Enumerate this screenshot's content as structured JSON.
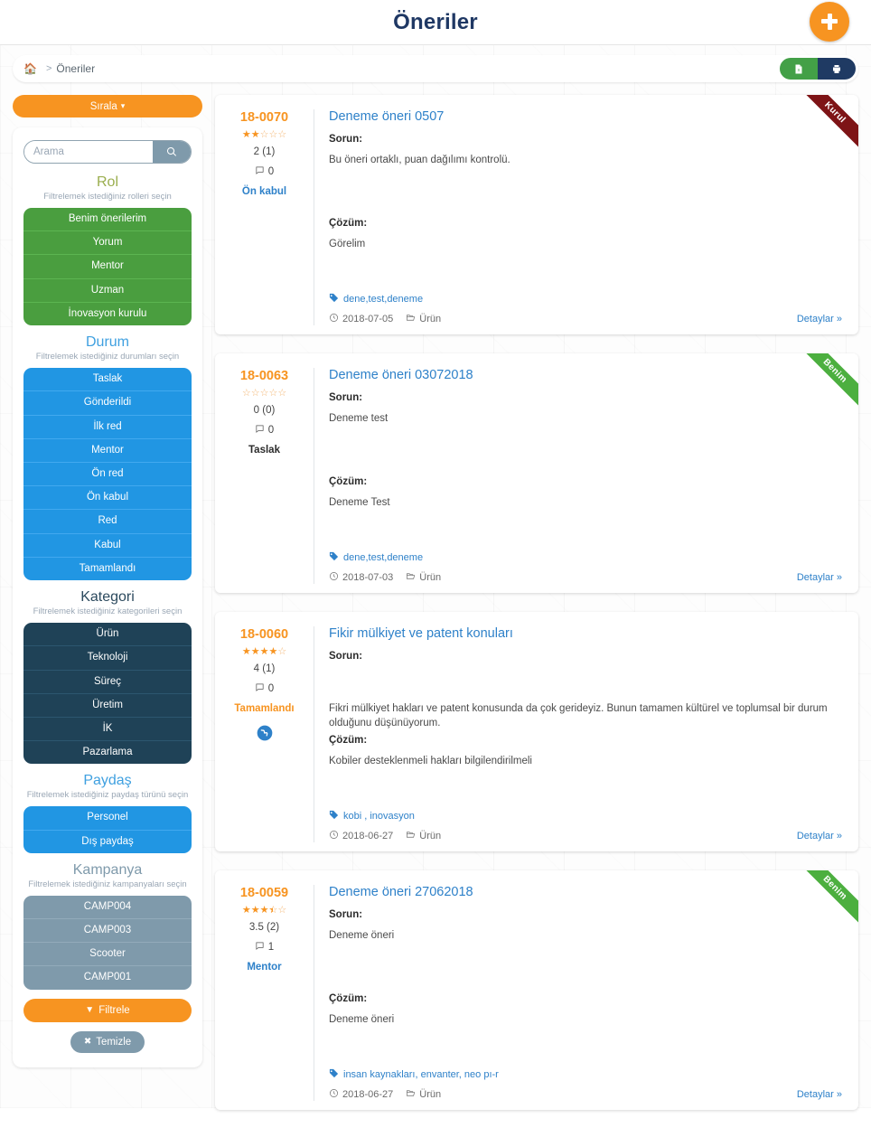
{
  "header": {
    "title": "Öneriler",
    "add_button_label": "+",
    "add_button_icon": "plus-icon"
  },
  "breadcrumb": {
    "home_icon": "home-icon",
    "separator": ">",
    "current": "Öneriler",
    "actions": [
      {
        "name": "export-excel-button",
        "icon": "file-excel-icon"
      },
      {
        "name": "print-button",
        "icon": "printer-icon"
      }
    ]
  },
  "sidebar": {
    "sort_label": "Sırala",
    "sort_icon": "sort-updown-icon",
    "search": {
      "placeholder": "Arama",
      "value": "",
      "icon": "search-icon"
    },
    "groups": [
      {
        "key": "rol",
        "title": "Rol",
        "subtitle": "Filtrelemek istediğiniz rolleri seçin",
        "options": [
          "Benim önerilerim",
          "Yorum",
          "Mentor",
          "Uzman",
          "İnovasyon kurulu"
        ]
      },
      {
        "key": "durum",
        "title": "Durum",
        "subtitle": "Filtrelemek istediğiniz durumları seçin",
        "options": [
          "Taslak",
          "Gönderildi",
          "İlk red",
          "Mentor",
          "Ön red",
          "Ön kabul",
          "Red",
          "Kabul",
          "Tamamlandı"
        ]
      },
      {
        "key": "kategori",
        "title": "Kategori",
        "subtitle": "Filtrelemek istediğiniz kategorileri seçin",
        "options": [
          "Ürün",
          "Teknoloji",
          "Süreç",
          "Üretim",
          "İK",
          "Pazarlama"
        ]
      },
      {
        "key": "paydas",
        "title": "Paydaş",
        "subtitle": "Filtrelemek istediğiniz paydaş türünü seçin",
        "options": [
          "Personel",
          "Dış paydaş"
        ]
      },
      {
        "key": "kampanya",
        "title": "Kampanya",
        "subtitle": "Filtrelemek istediğiniz kampanyaları seçin",
        "options": [
          "CAMP004",
          "CAMP003",
          "Scooter",
          "CAMP001"
        ]
      }
    ],
    "filter_button": {
      "label": "Filtrele",
      "icon": "funnel-icon"
    },
    "clear_button": {
      "label": "Temizle",
      "icon": "x-icon"
    }
  },
  "labels": {
    "problem": "Sorun:",
    "solution": "Çözüm:",
    "details": "Detaylar »",
    "tag_icon": "tag-icon",
    "date_icon": "clock-icon",
    "category_icon": "folder-open-icon",
    "comment_icon": "comment-icon"
  },
  "cards": [
    {
      "code": "18-0070",
      "title": "Deneme öneri 0507",
      "rating": 2,
      "rating_text": "2 (1)",
      "comments": "0",
      "state": "Ön kabul",
      "state_style": "state-blue",
      "ribbon": {
        "label": "Kurul",
        "style": "ribbon-kurul"
      },
      "globe": false,
      "problem": "Bu öneri ortaklı, puan dağılımı kontrolü.",
      "problem_align": "top",
      "solution": "Görelim",
      "tags": "dene,test,deneme",
      "date": "2018-07-05",
      "category": "Ürün"
    },
    {
      "code": "18-0063",
      "title": "Deneme öneri 03072018",
      "rating": 0,
      "rating_text": "0 (0)",
      "comments": "0",
      "state": "Taslak",
      "state_style": "state-dark",
      "ribbon": {
        "label": "Benim",
        "style": "ribbon-benim"
      },
      "globe": false,
      "problem": "Deneme test",
      "problem_align": "top",
      "solution": "Deneme Test",
      "tags": "dene,test,deneme",
      "date": "2018-07-03",
      "category": "Ürün"
    },
    {
      "code": "18-0060",
      "title": "Fikir mülkiyet ve patent konuları",
      "rating": 4,
      "rating_text": "4 (1)",
      "comments": "0",
      "state": "Tamamlandı",
      "state_style": "state-orange",
      "ribbon": null,
      "globe": true,
      "problem": "Fikri mülkiyet hakları ve patent konusunda da çok gerideyiz. Bunun tamamen kültürel ve toplumsal bir durum olduğunu düşünüyorum.",
      "problem_align": "bottom",
      "solution": "Kobiler desteklenmeli hakları bilgilendirilmeli",
      "tags": "kobi , inovasyon",
      "date": "2018-06-27",
      "category": "Ürün"
    },
    {
      "code": "18-0059",
      "title": "Deneme öneri 27062018",
      "rating": 3.5,
      "rating_text": "3.5 (2)",
      "comments": "1",
      "state": "Mentor",
      "state_style": "state-blue",
      "ribbon": {
        "label": "Benim",
        "style": "ribbon-benim"
      },
      "globe": false,
      "problem": "Deneme öneri",
      "problem_align": "top",
      "solution": "Deneme öneri",
      "tags": "insan kaynakları, envanter, neo pı-r",
      "date": "2018-06-27",
      "category": "Ürün"
    }
  ],
  "colors": {
    "brand_orange": "#f79421",
    "brand_blue": "#2e81c9",
    "title_navy": "#1f3864",
    "green": "#4a9e3f",
    "ribbon_red": "#7e1416"
  }
}
